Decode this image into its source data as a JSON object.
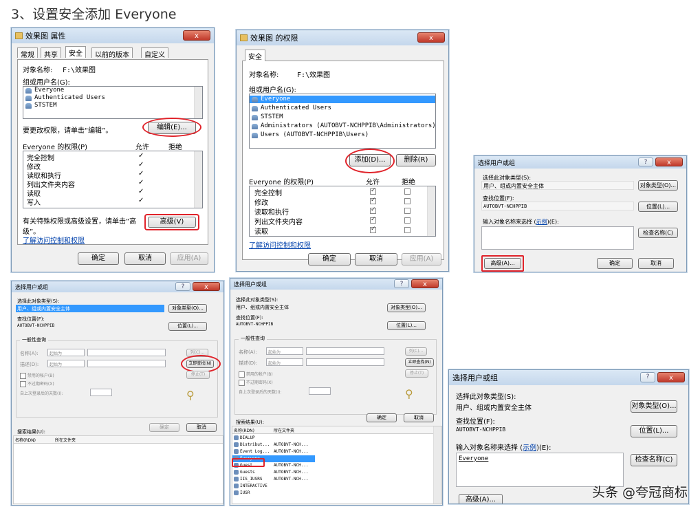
{
  "heading": "3、设置安全添加 Everyone",
  "watermark": "头条 @夸冠商标",
  "w1": {
    "title": "效果图 属性",
    "tabs": [
      "常规",
      "共享",
      "安全",
      "以前的版本",
      "自定义"
    ],
    "obj_label": "对象名称:",
    "obj_value": "F:\\效果图",
    "group_label": "组或用户名(G):",
    "users": [
      "Everyone",
      "Authenticated Users",
      "STSTEM"
    ],
    "change_hint": "要更改权限，请单击“编辑”。",
    "edit": "编辑(E)...",
    "perm_title": "Everyone 的权限(P)",
    "allow": "允许",
    "deny": "拒绝",
    "perms": [
      "完全控制",
      "修改",
      "读取和执行",
      "列出文件夹内容",
      "读取",
      "写入"
    ],
    "check": "✓",
    "adv_hint": "有关特殊权限或高级设置，请单击“高级”。",
    "advanced": "高级(V)",
    "learn": "了解访问控制和权限",
    "ok": "确定",
    "cancel": "取消",
    "apply": "应用(A)",
    "close": "x"
  },
  "w2": {
    "title": "效果图 的权限",
    "tab": "安全",
    "obj_label": "对象名称:",
    "obj_value": "F:\\效果图",
    "group_label": "组或用户名(G):",
    "users": [
      "Everyone",
      "Authenticated Users",
      "STSTEM",
      "Administrators (AUTOBVT-NCHPPIB\\Administrators)",
      "Users (AUTOBVT-NCHPPIB\\Users)"
    ],
    "add": "添加(D)...",
    "remove": "删除(R)",
    "perm_title": "Everyone 的权限(P)",
    "allow": "允许",
    "deny": "拒绝",
    "perms": [
      "完全控制",
      "修改",
      "读取和执行",
      "列出文件夹内容",
      "读取"
    ],
    "learn": "了解访问控制和权限",
    "ok": "确定",
    "cancel": "取消",
    "apply": "应用(A)",
    "close": "x"
  },
  "w3": {
    "title": "选择用户或组",
    "type_label": "选择此对象类型(S):",
    "type_value": "用户、组或内置安全主体",
    "type_btn": "对象类型(O)...",
    "loc_label": "查找位置(F):",
    "loc_value": "AUTOBVT-NCHPPIB",
    "loc_btn": "位置(L)...",
    "enter_label": "输入对象名称来选择",
    "example": "示例",
    "enter_suffix": "(E):",
    "check_btn": "检查名称(C)",
    "advanced": "高级(A)...",
    "ok": "确定",
    "cancel": "取消",
    "help": "?",
    "close": "x"
  },
  "w4": {
    "title": "选择用户或组",
    "type_label": "选择此对象类型(S):",
    "type_value": "用户、组或内置安全主体",
    "type_btn": "对象类型(O)...",
    "loc_label": "查找位置(F):",
    "loc_value": "AUTOBVT-NCHPPIB",
    "loc_btn": "位置(L)...",
    "tab": "一般性查询",
    "name_label": "名称(A):",
    "desc_label": "描述(D):",
    "starts": "起始为",
    "cols": "列(C)...",
    "find": "立即查找(N)",
    "stop": "停止(T)",
    "disabled": "禁用的帐户(B)",
    "noexp": "不过期密码(X)",
    "days": "自上次登录后的天数(I):",
    "ok": "确定",
    "cancel": "取消",
    "results": "搜索结果(U):",
    "col_name": "名称(RDN)",
    "col_folder": "所在文件夹",
    "help": "?",
    "close": "x"
  },
  "w5": {
    "title": "选择用户或组",
    "type_label": "选择此对象类型(S):",
    "type_value": "用户、组或内置安全主体",
    "type_btn": "对象类型(O)...",
    "loc_label": "查找位置(F):",
    "loc_value": "AUTOBVT-NCHPPIB",
    "loc_btn": "位置(L)...",
    "tab": "一般性查询",
    "name_label": "名称(A):",
    "desc_label": "描述(D):",
    "starts": "起始为",
    "cols": "列(C)...",
    "find": "立即查找(N)",
    "stop": "停止(T)",
    "disabled": "禁用的帐户(B)",
    "noexp": "不过期密码(X)",
    "days": "自上次登录后的天数(I):",
    "ok": "确定",
    "cancel": "取消",
    "results": "搜索结果(U):",
    "col_name": "名称(RDN)",
    "col_folder": "所在文件夹",
    "rows": [
      {
        "n": "DIALUP",
        "f": ""
      },
      {
        "n": "Distribut...",
        "f": "AUTOBVT-NCH..."
      },
      {
        "n": "Event Log...",
        "f": "AUTOBVT-NCH..."
      },
      {
        "n": "Everyone",
        "f": ""
      },
      {
        "n": "Guest",
        "f": "AUTOBVT-NCH..."
      },
      {
        "n": "Guests",
        "f": "AUTOBVT-NCH..."
      },
      {
        "n": "IIS_IUSRS",
        "f": "AUTOBVT-NCH..."
      },
      {
        "n": "INTERACTIVE",
        "f": ""
      },
      {
        "n": "IUSR",
        "f": ""
      }
    ],
    "help": "?",
    "close": "x"
  },
  "w6": {
    "title": "选择用户或组",
    "type_label": "选择此对象类型(S):",
    "type_value": "用户、组或内置安全主体",
    "type_btn": "对象类型(O)...",
    "loc_label": "查找位置(F):",
    "loc_value": "AUTOBVT-NCHPPIB",
    "loc_btn": "位置(L)...",
    "enter_label": "输入对象名称来选择",
    "example": "示例",
    "enter_suffix": "(E):",
    "entered": "Everyone",
    "check_btn": "检查名称(C)",
    "advanced": "高级(A)...",
    "help": "?",
    "close": "x"
  }
}
